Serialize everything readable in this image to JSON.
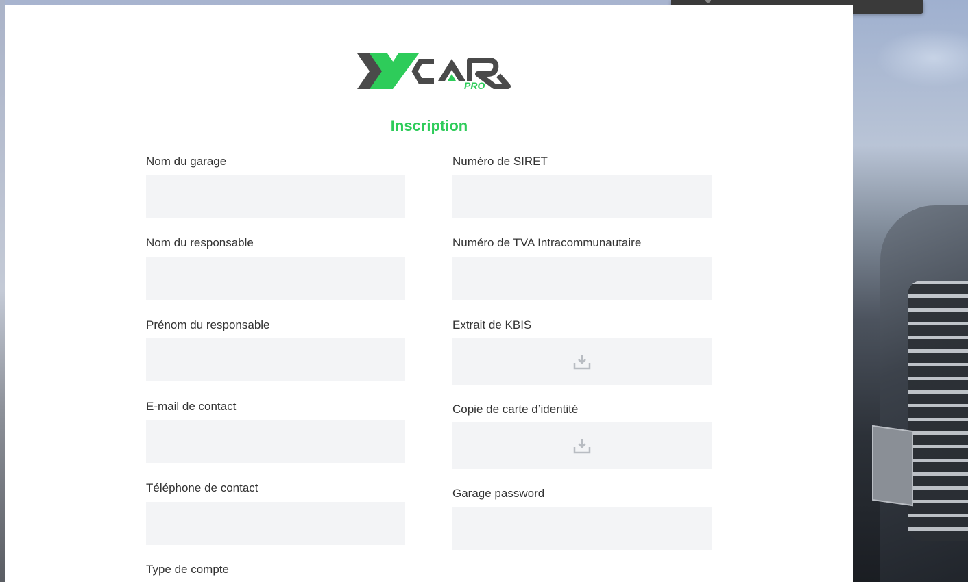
{
  "logo": {
    "main": "XCAR",
    "sub": "PRO",
    "colors": {
      "green": "#2ecc5a",
      "gray": "#4a4a4a"
    }
  },
  "title": "Inscription",
  "left_fields": [
    {
      "label": "Nom du garage",
      "value": ""
    },
    {
      "label": "Nom du responsable",
      "value": ""
    },
    {
      "label": "Prénom du responsable",
      "value": ""
    },
    {
      "label": "E-mail de contact",
      "value": ""
    },
    {
      "label": "Téléphone de contact",
      "value": ""
    },
    {
      "label": "Type de compte",
      "value": ""
    }
  ],
  "right_fields": [
    {
      "label": "Numéro de SIRET",
      "value": ""
    },
    {
      "label": "Numéro de TVA Intracommunautaire",
      "value": ""
    },
    {
      "label": "Extrait de KBIS",
      "icon": "download-tray-icon"
    },
    {
      "label": "Copie de carte d’identité",
      "icon": "download-tray-icon"
    },
    {
      "label": "Garage password",
      "value": ""
    }
  ],
  "colors": {
    "accent": "#2ecc5a",
    "input_bg": "#f3f4f6",
    "label_text": "#333333"
  }
}
